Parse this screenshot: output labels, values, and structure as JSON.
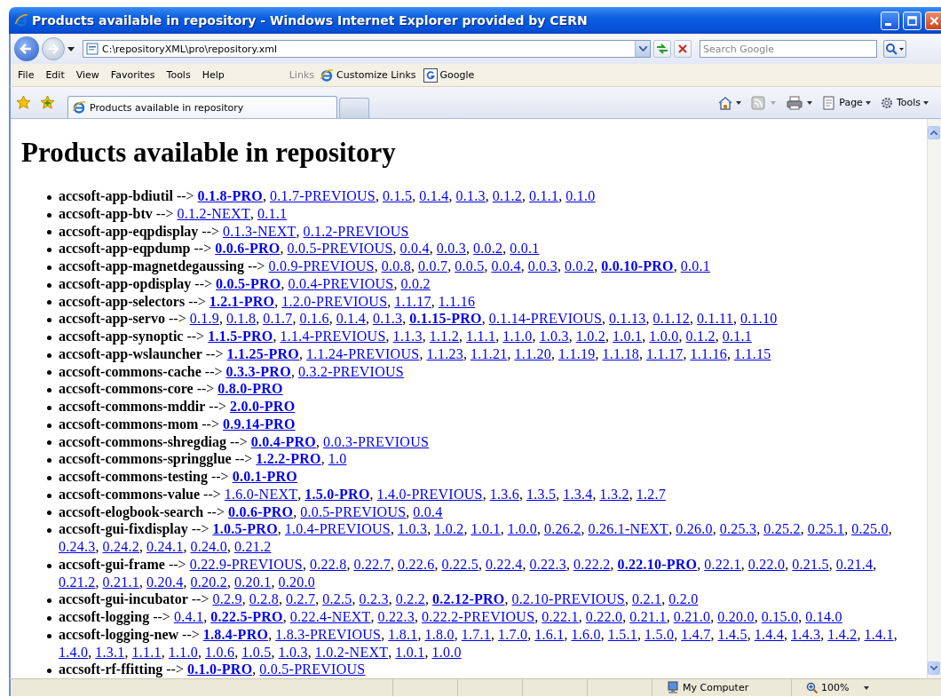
{
  "window": {
    "title": "Products available in repository - Windows Internet Explorer provided by CERN"
  },
  "address_bar": {
    "url": "C:\\repositoryXML\\pro\\repository.xml",
    "search": {
      "placeholder": "Search Google"
    }
  },
  "menu_bar": {
    "items": [
      "File",
      "Edit",
      "View",
      "Favorites",
      "Tools",
      "Help"
    ],
    "links_label": "Links",
    "links": [
      "Customize Links",
      "Google"
    ]
  },
  "tabs": [
    {
      "label": "Products available in repository",
      "selected": true
    }
  ],
  "command_bar": {
    "items": [
      "Page",
      "Tools"
    ]
  },
  "page": {
    "heading": "Products available in repository",
    "separator": ",",
    "products": [
      {
        "name": "accsoft-app-bdiutil",
        "arrow": "-->",
        "versions": [
          {
            "label": "0.1.8-PRO",
            "current": true
          },
          {
            "label": "0.1.7-PREVIOUS",
            "current": false
          },
          {
            "label": "0.1.5",
            "current": false
          },
          {
            "label": "0.1.4",
            "current": false
          },
          {
            "label": "0.1.3",
            "current": false
          },
          {
            "label": "0.1.2",
            "current": false
          },
          {
            "label": "0.1.1",
            "current": false
          },
          {
            "label": "0.1.0",
            "current": false
          }
        ]
      },
      {
        "name": "accsoft-app-btv",
        "arrow": "-->",
        "versions": [
          {
            "label": "0.1.2-NEXT",
            "current": false
          },
          {
            "label": "0.1.1",
            "current": false
          }
        ]
      },
      {
        "name": "accsoft-app-eqpdisplay",
        "arrow": "-->",
        "versions": [
          {
            "label": "0.1.3-NEXT",
            "current": false
          },
          {
            "label": "0.1.2-PREVIOUS",
            "current": false
          }
        ]
      },
      {
        "name": "accsoft-app-eqpdump",
        "arrow": "-->",
        "versions": [
          {
            "label": "0.0.6-PRO",
            "current": true
          },
          {
            "label": "0.0.5-PREVIOUS",
            "current": false
          },
          {
            "label": "0.0.4",
            "current": false
          },
          {
            "label": "0.0.3",
            "current": false
          },
          {
            "label": "0.0.2",
            "current": false
          },
          {
            "label": "0.0.1",
            "current": false
          }
        ]
      },
      {
        "name": "accsoft-app-magnetdegaussing",
        "arrow": "-->",
        "versions": [
          {
            "label": "0.0.9-PREVIOUS",
            "current": false
          },
          {
            "label": "0.0.8",
            "current": false
          },
          {
            "label": "0.0.7",
            "current": false
          },
          {
            "label": "0.0.5",
            "current": false
          },
          {
            "label": "0.0.4",
            "current": false
          },
          {
            "label": "0.0.3",
            "current": false
          },
          {
            "label": "0.0.2",
            "current": false
          },
          {
            "label": "0.0.10-PRO",
            "current": true
          },
          {
            "label": "0.0.1",
            "current": false
          }
        ]
      },
      {
        "name": "accsoft-app-opdisplay",
        "arrow": "-->",
        "versions": [
          {
            "label": "0.0.5-PRO",
            "current": true
          },
          {
            "label": "0.0.4-PREVIOUS",
            "current": false
          },
          {
            "label": "0.0.2",
            "current": false
          }
        ]
      },
      {
        "name": "accsoft-app-selectors",
        "arrow": "-->",
        "versions": [
          {
            "label": "1.2.1-PRO",
            "current": true
          },
          {
            "label": "1.2.0-PREVIOUS",
            "current": false
          },
          {
            "label": "1.1.17",
            "current": false
          },
          {
            "label": "1.1.16",
            "current": false
          }
        ]
      },
      {
        "name": "accsoft-app-servo",
        "arrow": "-->",
        "versions": [
          {
            "label": "0.1.9",
            "current": false
          },
          {
            "label": "0.1.8",
            "current": false
          },
          {
            "label": "0.1.7",
            "current": false
          },
          {
            "label": "0.1.6",
            "current": false
          },
          {
            "label": "0.1.4",
            "current": false
          },
          {
            "label": "0.1.3",
            "current": false
          },
          {
            "label": "0.1.15-PRO",
            "current": true
          },
          {
            "label": "0.1.14-PREVIOUS",
            "current": false
          },
          {
            "label": "0.1.13",
            "current": false
          },
          {
            "label": "0.1.12",
            "current": false
          },
          {
            "label": "0.1.11",
            "current": false
          },
          {
            "label": "0.1.10",
            "current": false
          }
        ]
      },
      {
        "name": "accsoft-app-synoptic",
        "arrow": "-->",
        "versions": [
          {
            "label": "1.1.5-PRO",
            "current": true
          },
          {
            "label": "1.1.4-PREVIOUS",
            "current": false
          },
          {
            "label": "1.1.3",
            "current": false
          },
          {
            "label": "1.1.2",
            "current": false
          },
          {
            "label": "1.1.1",
            "current": false
          },
          {
            "label": "1.1.0",
            "current": false
          },
          {
            "label": "1.0.3",
            "current": false
          },
          {
            "label": "1.0.2",
            "current": false
          },
          {
            "label": "1.0.1",
            "current": false
          },
          {
            "label": "1.0.0",
            "current": false
          },
          {
            "label": "0.1.2",
            "current": false
          },
          {
            "label": "0.1.1",
            "current": false
          }
        ]
      },
      {
        "name": "accsoft-app-wslauncher",
        "arrow": "-->",
        "versions": [
          {
            "label": "1.1.25-PRO",
            "current": true
          },
          {
            "label": "1.1.24-PREVIOUS",
            "current": false
          },
          {
            "label": "1.1.23",
            "current": false
          },
          {
            "label": "1.1.21",
            "current": false
          },
          {
            "label": "1.1.20",
            "current": false
          },
          {
            "label": "1.1.19",
            "current": false
          },
          {
            "label": "1.1.18",
            "current": false
          },
          {
            "label": "1.1.17",
            "current": false
          },
          {
            "label": "1.1.16",
            "current": false
          },
          {
            "label": "1.1.15",
            "current": false
          }
        ]
      },
      {
        "name": "accsoft-commons-cache",
        "arrow": "-->",
        "versions": [
          {
            "label": "0.3.3-PRO",
            "current": true
          },
          {
            "label": "0.3.2-PREVIOUS",
            "current": false
          }
        ]
      },
      {
        "name": "accsoft-commons-core",
        "arrow": "-->",
        "versions": [
          {
            "label": "0.8.0-PRO",
            "current": true
          }
        ]
      },
      {
        "name": "accsoft-commons-mddir",
        "arrow": "-->",
        "versions": [
          {
            "label": "2.0.0-PRO",
            "current": true
          }
        ]
      },
      {
        "name": "accsoft-commons-mom",
        "arrow": "-->",
        "versions": [
          {
            "label": "0.9.14-PRO",
            "current": true
          }
        ]
      },
      {
        "name": "accsoft-commons-shregdiag",
        "arrow": "-->",
        "versions": [
          {
            "label": "0.0.4-PRO",
            "current": true
          },
          {
            "label": "0.0.3-PREVIOUS",
            "current": false
          }
        ]
      },
      {
        "name": "accsoft-commons-springglue",
        "arrow": "-->",
        "versions": [
          {
            "label": "1.2.2-PRO",
            "current": true
          },
          {
            "label": "1.0",
            "current": false
          }
        ]
      },
      {
        "name": "accsoft-commons-testing",
        "arrow": "-->",
        "versions": [
          {
            "label": "0.0.1-PRO",
            "current": true
          }
        ]
      },
      {
        "name": "accsoft-commons-value",
        "arrow": "-->",
        "versions": [
          {
            "label": "1.6.0-NEXT",
            "current": false
          },
          {
            "label": "1.5.0-PRO",
            "current": true
          },
          {
            "label": "1.4.0-PREVIOUS",
            "current": false
          },
          {
            "label": "1.3.6",
            "current": false
          },
          {
            "label": "1.3.5",
            "current": false
          },
          {
            "label": "1.3.4",
            "current": false
          },
          {
            "label": "1.3.2",
            "current": false
          },
          {
            "label": "1.2.7",
            "current": false
          }
        ]
      },
      {
        "name": "accsoft-elogbook-search",
        "arrow": "-->",
        "versions": [
          {
            "label": "0.0.6-PRO",
            "current": true
          },
          {
            "label": "0.0.5-PREVIOUS",
            "current": false
          },
          {
            "label": "0.0.4",
            "current": false
          }
        ]
      },
      {
        "name": "accsoft-gui-fixdisplay",
        "arrow": "-->",
        "versions": [
          {
            "label": "1.0.5-PRO",
            "current": true
          },
          {
            "label": "1.0.4-PREVIOUS",
            "current": false
          },
          {
            "label": "1.0.3",
            "current": false
          },
          {
            "label": "1.0.2",
            "current": false
          },
          {
            "label": "1.0.1",
            "current": false
          },
          {
            "label": "1.0.0",
            "current": false
          },
          {
            "label": "0.26.2",
            "current": false
          },
          {
            "label": "0.26.1-NEXT",
            "current": false
          },
          {
            "label": "0.26.0",
            "current": false
          },
          {
            "label": "0.25.3",
            "current": false
          },
          {
            "label": "0.25.2",
            "current": false
          },
          {
            "label": "0.25.1",
            "current": false
          },
          {
            "label": "0.25.0",
            "current": false
          },
          {
            "label": "0.24.3",
            "current": false
          },
          {
            "label": "0.24.2",
            "current": false
          },
          {
            "label": "0.24.1",
            "current": false
          },
          {
            "label": "0.24.0",
            "current": false
          },
          {
            "label": "0.21.2",
            "current": false
          }
        ]
      },
      {
        "name": "accsoft-gui-frame",
        "arrow": "-->",
        "versions": [
          {
            "label": "0.22.9-PREVIOUS",
            "current": false
          },
          {
            "label": "0.22.8",
            "current": false
          },
          {
            "label": "0.22.7",
            "current": false
          },
          {
            "label": "0.22.6",
            "current": false
          },
          {
            "label": "0.22.5",
            "current": false
          },
          {
            "label": "0.22.4",
            "current": false
          },
          {
            "label": "0.22.3",
            "current": false
          },
          {
            "label": "0.22.2",
            "current": false
          },
          {
            "label": "0.22.10-PRO",
            "current": true
          },
          {
            "label": "0.22.1",
            "current": false
          },
          {
            "label": "0.22.0",
            "current": false
          },
          {
            "label": "0.21.5",
            "current": false
          },
          {
            "label": "0.21.4",
            "current": false
          },
          {
            "label": "0.21.2",
            "current": false
          },
          {
            "label": "0.21.1",
            "current": false
          },
          {
            "label": "0.20.4",
            "current": false
          },
          {
            "label": "0.20.2",
            "current": false
          },
          {
            "label": "0.20.1",
            "current": false
          },
          {
            "label": "0.20.0",
            "current": false
          }
        ]
      },
      {
        "name": "accsoft-gui-incubator",
        "arrow": "-->",
        "versions": [
          {
            "label": "0.2.9",
            "current": false
          },
          {
            "label": "0.2.8",
            "current": false
          },
          {
            "label": "0.2.7",
            "current": false
          },
          {
            "label": "0.2.5",
            "current": false
          },
          {
            "label": "0.2.3",
            "current": false
          },
          {
            "label": "0.2.2",
            "current": false
          },
          {
            "label": "0.2.12-PRO",
            "current": true
          },
          {
            "label": "0.2.10-PREVIOUS",
            "current": false
          },
          {
            "label": "0.2.1",
            "current": false
          },
          {
            "label": "0.2.0",
            "current": false
          }
        ]
      },
      {
        "name": "accsoft-logging",
        "arrow": "-->",
        "versions": [
          {
            "label": "0.4.1",
            "current": false
          },
          {
            "label": "0.22.5-PRO",
            "current": true
          },
          {
            "label": "0.22.4-NEXT",
            "current": false
          },
          {
            "label": "0.22.3",
            "current": false
          },
          {
            "label": "0.22.2-PREVIOUS",
            "current": false
          },
          {
            "label": "0.22.1",
            "current": false
          },
          {
            "label": "0.22.0",
            "current": false
          },
          {
            "label": "0.21.1",
            "current": false
          },
          {
            "label": "0.21.0",
            "current": false
          },
          {
            "label": "0.20.0",
            "current": false
          },
          {
            "label": "0.15.0",
            "current": false
          },
          {
            "label": "0.14.0",
            "current": false
          }
        ]
      },
      {
        "name": "accsoft-logging-new",
        "arrow": "-->",
        "versions": [
          {
            "label": "1.8.4-PRO",
            "current": true
          },
          {
            "label": "1.8.3-PREVIOUS",
            "current": false
          },
          {
            "label": "1.8.1",
            "current": false
          },
          {
            "label": "1.8.0",
            "current": false
          },
          {
            "label": "1.7.1",
            "current": false
          },
          {
            "label": "1.7.0",
            "current": false
          },
          {
            "label": "1.6.1",
            "current": false
          },
          {
            "label": "1.6.0",
            "current": false
          },
          {
            "label": "1.5.1",
            "current": false
          },
          {
            "label": "1.5.0",
            "current": false
          },
          {
            "label": "1.4.7",
            "current": false
          },
          {
            "label": "1.4.5",
            "current": false
          },
          {
            "label": "1.4.4",
            "current": false
          },
          {
            "label": "1.4.3",
            "current": false
          },
          {
            "label": "1.4.2",
            "current": false
          },
          {
            "label": "1.4.1",
            "current": false
          },
          {
            "label": "1.4.0",
            "current": false
          },
          {
            "label": "1.3.1",
            "current": false
          },
          {
            "label": "1.1.1",
            "current": false
          },
          {
            "label": "1.1.0",
            "current": false
          },
          {
            "label": "1.0.6",
            "current": false
          },
          {
            "label": "1.0.5",
            "current": false
          },
          {
            "label": "1.0.3",
            "current": false
          },
          {
            "label": "1.0.2-NEXT",
            "current": false
          },
          {
            "label": "1.0.1",
            "current": false
          },
          {
            "label": "1.0.0",
            "current": false
          }
        ]
      },
      {
        "name": "accsoft-rf-ffitting",
        "arrow": "-->",
        "versions": [
          {
            "label": "0.1.0-PRO",
            "current": true
          },
          {
            "label": "0.0.5-PREVIOUS",
            "current": false
          }
        ]
      }
    ]
  },
  "status_bar": {
    "zone": "My Computer",
    "zoom": "100%"
  }
}
